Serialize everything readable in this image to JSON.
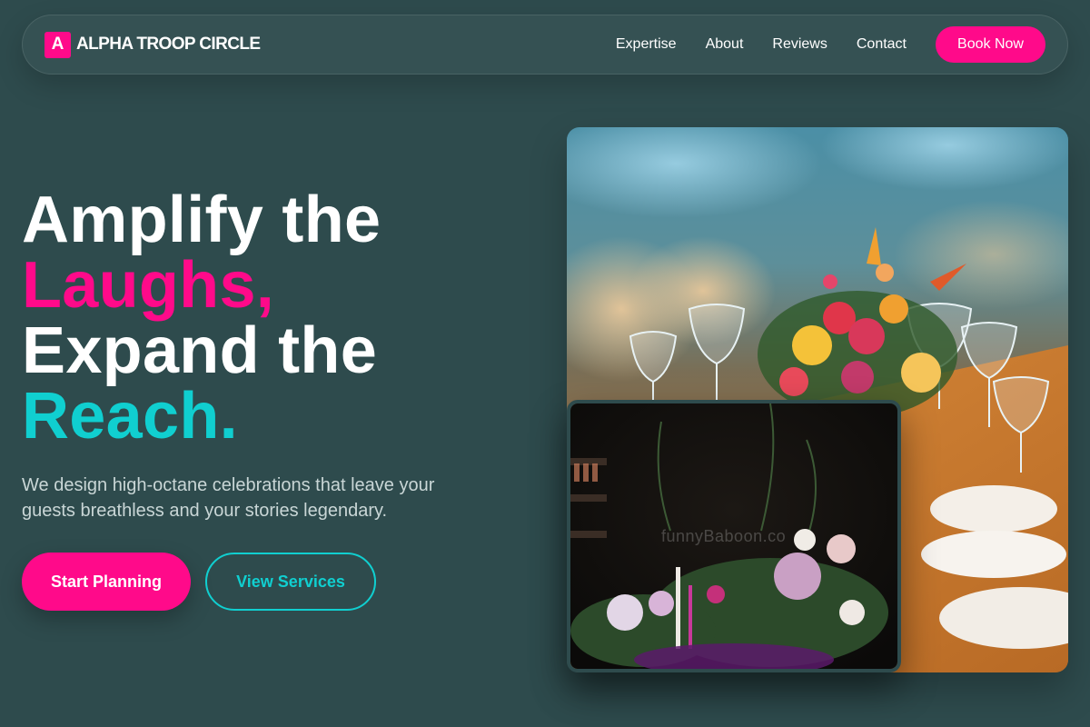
{
  "brand": {
    "mark": "A",
    "name": "ALPHA TROOP CIRCLE"
  },
  "nav": {
    "links": [
      {
        "label": "Expertise"
      },
      {
        "label": "About"
      },
      {
        "label": "Reviews"
      },
      {
        "label": "Contact"
      }
    ],
    "cta_label": "Book Now"
  },
  "hero": {
    "line1": "Amplify the",
    "line2": "Laughs,",
    "line3": "Expand the",
    "line4": "Reach.",
    "subtitle": "We design high-octane celebrations that leave your guests breathless and your stories legendary.",
    "primary_cta": "Start Planning",
    "secondary_cta": "View Services"
  },
  "images": {
    "main": {
      "alt": "Banquet table with floral centerpiece and wine glasses"
    },
    "inset": {
      "alt": "Dark moody floral arrangement with candles",
      "watermark": "funnyBaboon.co"
    }
  },
  "colors": {
    "background": "#2e4b4d",
    "accent_pink": "#ff0a8a",
    "accent_cyan": "#10cfd0",
    "text_muted": "#c9d6d6"
  }
}
